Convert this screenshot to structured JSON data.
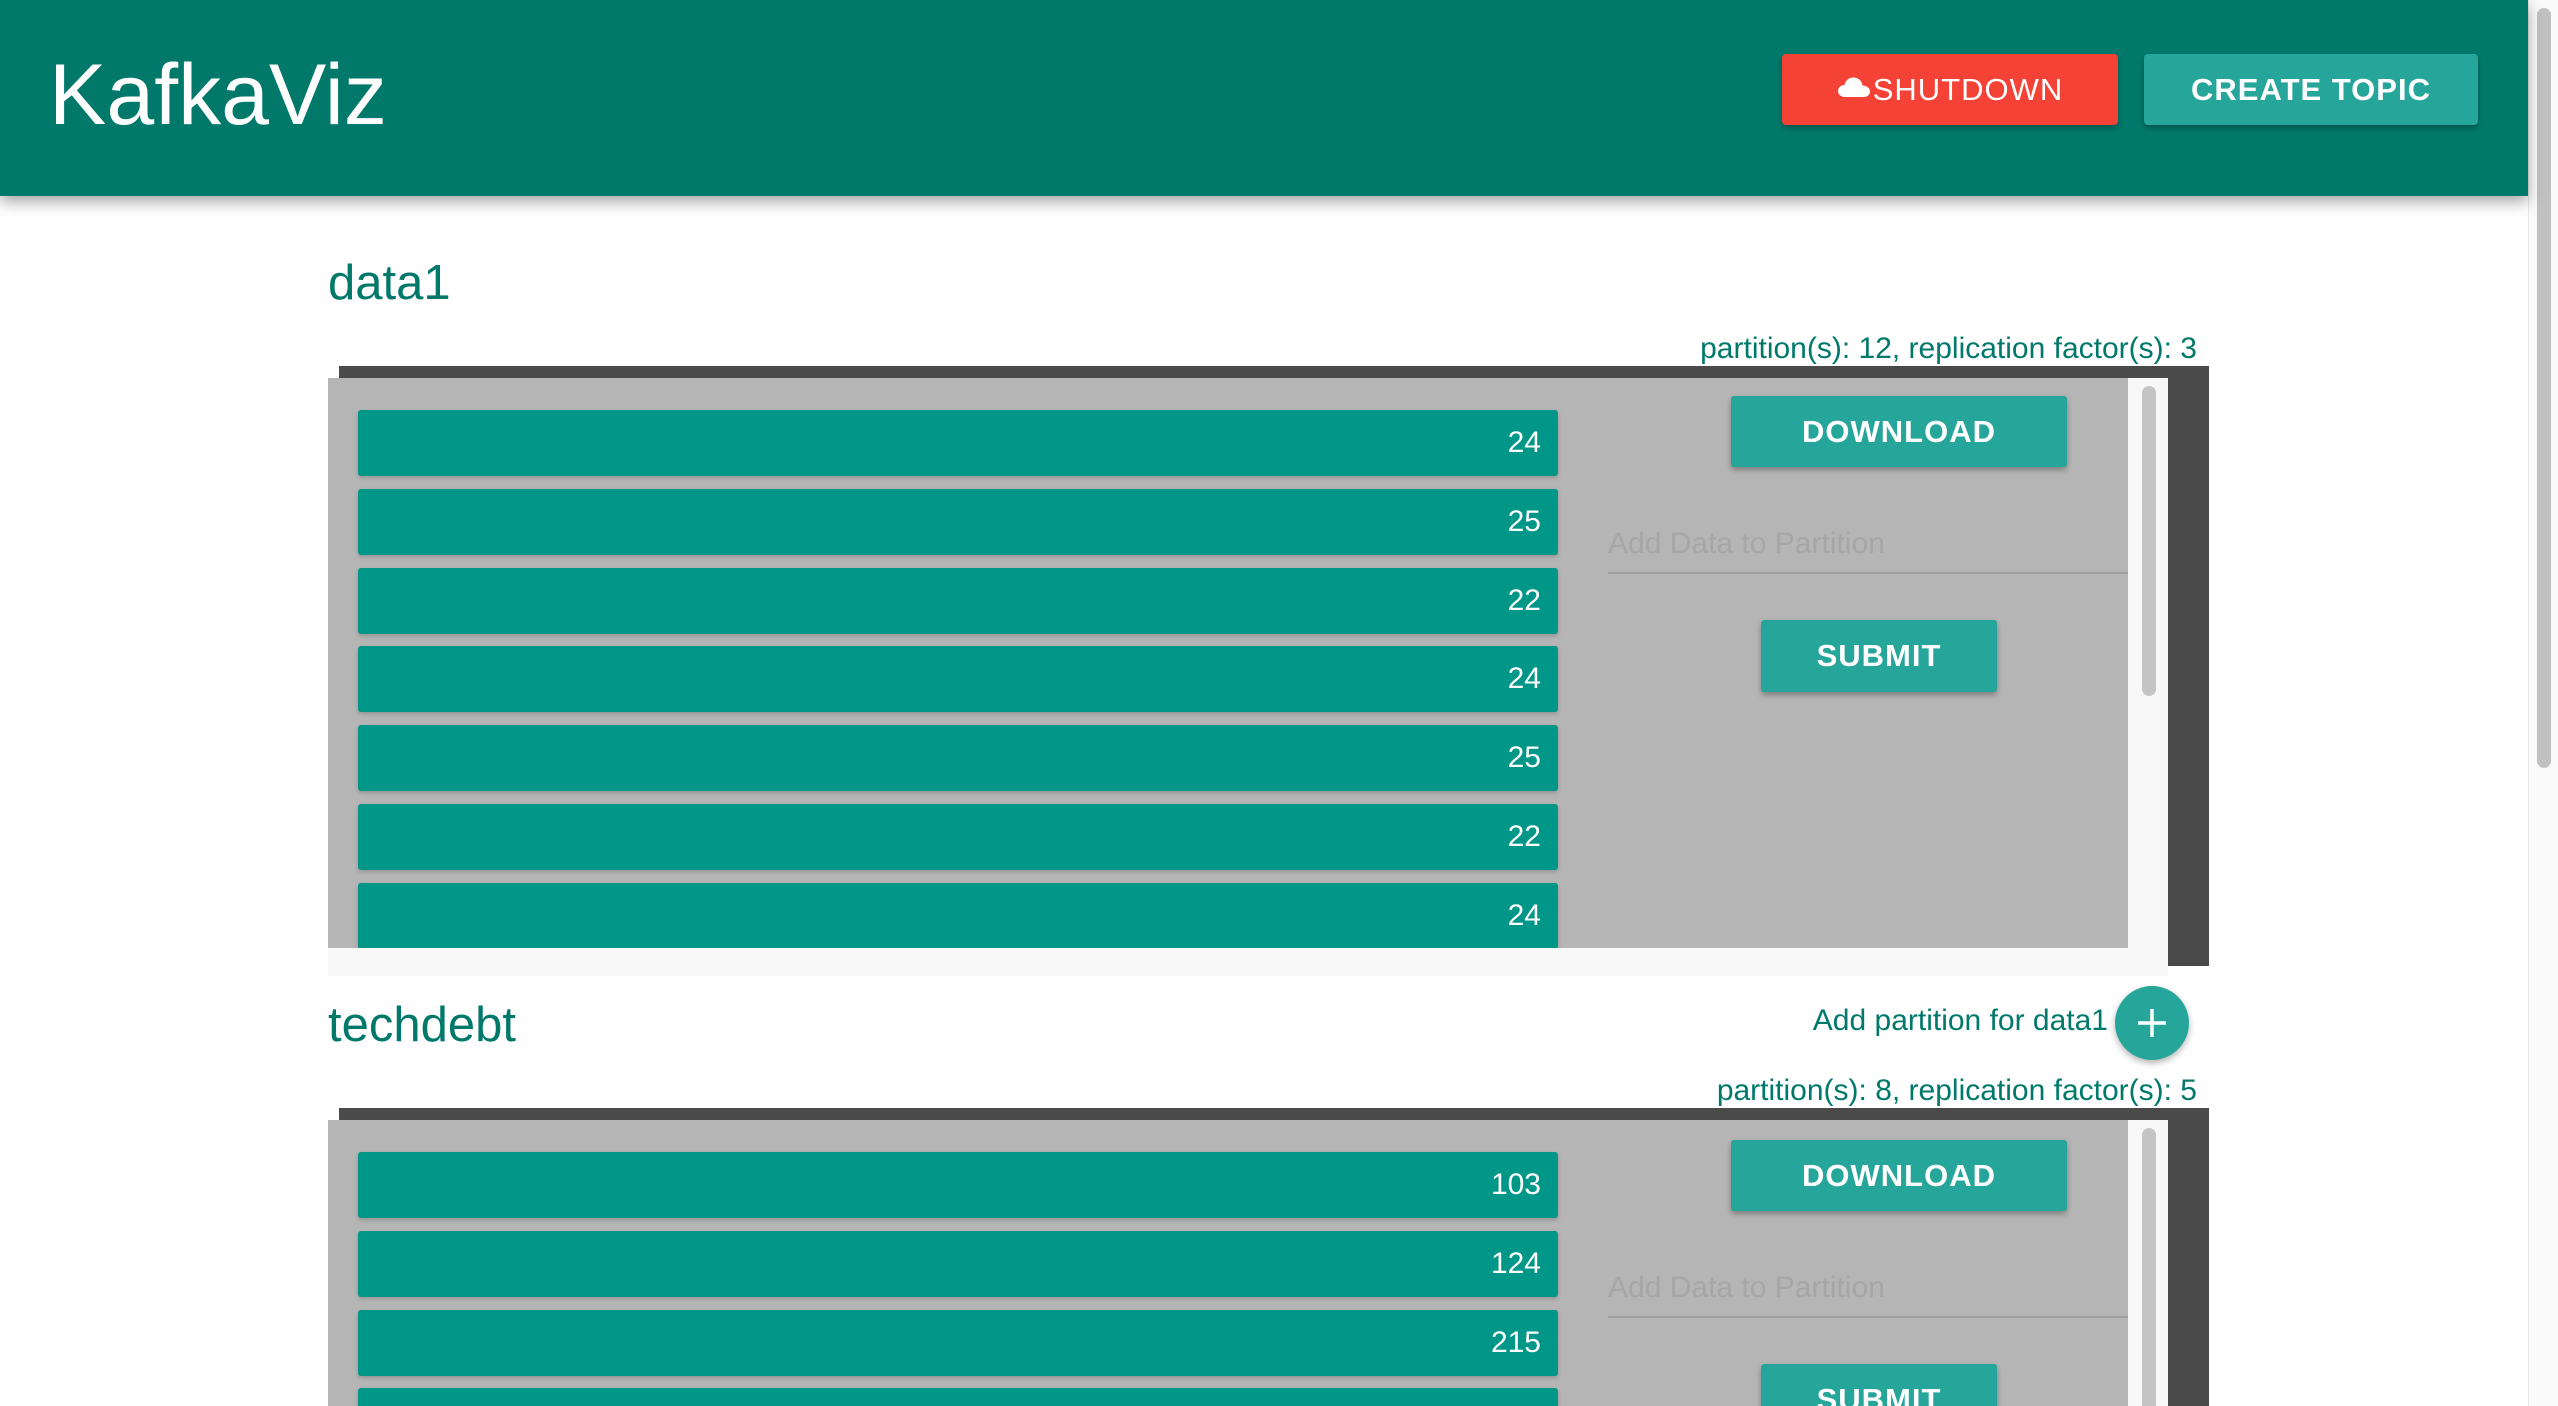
{
  "app": {
    "title": "KafkaViz",
    "shutdown_label": "SHUTDOWN",
    "shutdown_icon": "cloud-icon",
    "create_topic_label": "CREATE TOPIC",
    "colors": {
      "primary": "#00796b",
      "accent": "#26a69a",
      "partition_bar": "#009688",
      "danger": "#f44336",
      "panel_bg": "#b5b5b5"
    }
  },
  "topics": [
    {
      "name": "data1",
      "meta": "partition(s): 12, replication factor(s): 3",
      "partitions": [
        24,
        25,
        22,
        24,
        25,
        22,
        24
      ],
      "download_label": "DOWNLOAD",
      "input_placeholder": "Add Data to Partition",
      "submit_label": "SUBMIT",
      "add_partition_label": "Add partition for data1",
      "add_icon": "plus-icon"
    },
    {
      "name": "techdebt",
      "meta": "partition(s): 8, replication factor(s): 5",
      "partitions": [
        103,
        124,
        215
      ],
      "download_label": "DOWNLOAD",
      "input_placeholder": "Add Data to Partition",
      "submit_label": "SUBMIT"
    }
  ]
}
